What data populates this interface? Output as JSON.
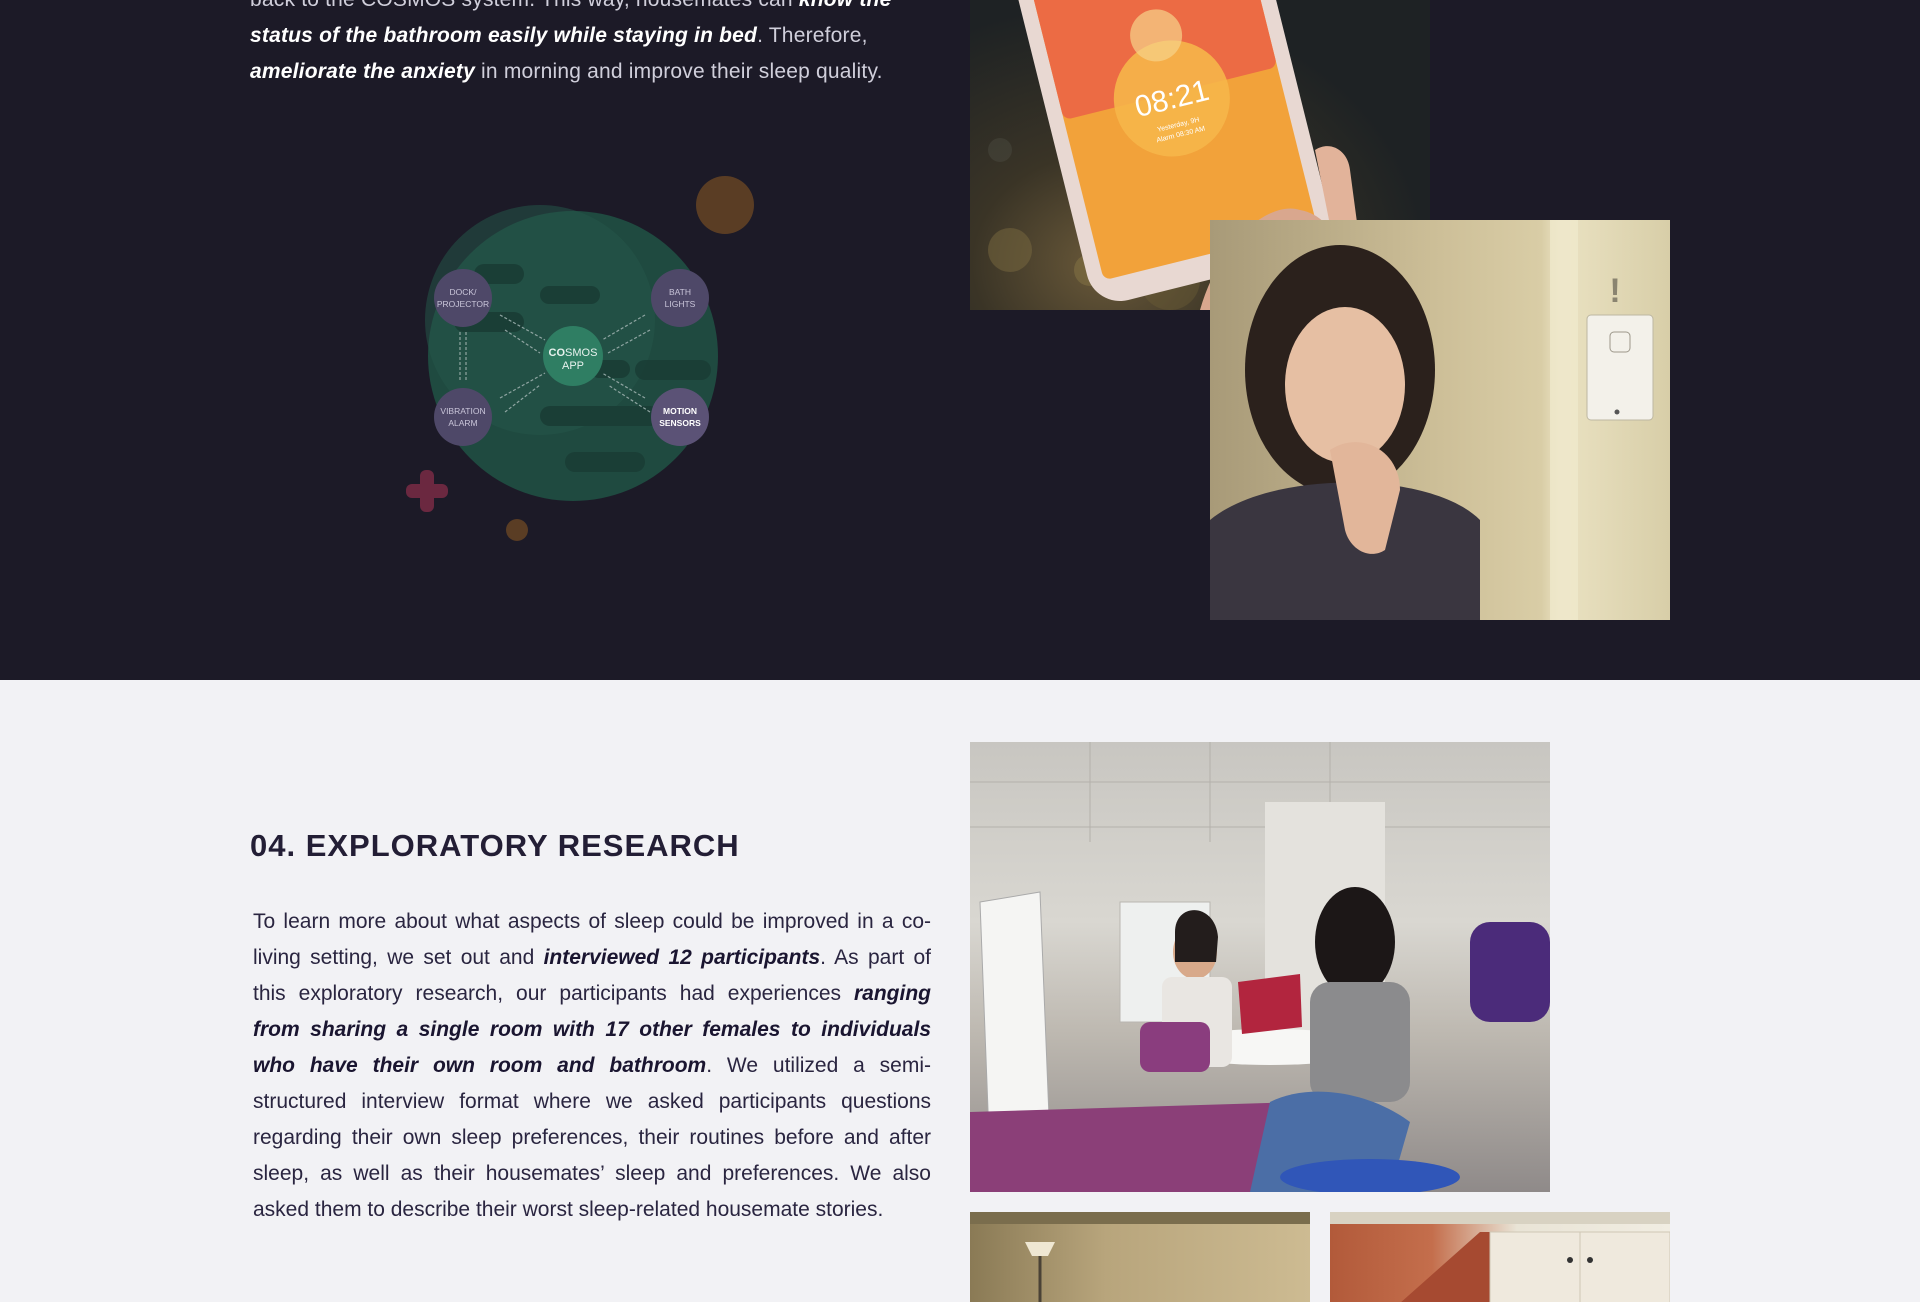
{
  "intro": {
    "line1_a": "back to the COSMOS system. This way, housemates can ",
    "line1_b": "know the status of the bathroom easily while staying in bed",
    "line2_a": ". Therefore, ",
    "line2_b": "ameliorate the anxiety",
    "line2_c": " in morning and improve their sleep quality."
  },
  "diagram": {
    "center_a": "CO",
    "center_b": "SMOS",
    "center_c": "APP",
    "nodes": {
      "dock": [
        "DOCK/",
        "PROJECTOR"
      ],
      "bath": [
        "BATH",
        "LIGHTS"
      ],
      "vibration": [
        "VIBRATION",
        "ALARM"
      ],
      "motion": [
        "MOTION",
        "SENSORS"
      ]
    }
  },
  "phone_screen": {
    "time": "08:21",
    "sub1": "Yesterday, 9H",
    "sub2": "Alarm 08:30 AM"
  },
  "research": {
    "title": "04. EXPLORATORY RESEARCH",
    "p1": "To learn more about what aspects of sleep could be improved in a co-living setting, we set out and ",
    "p1_b": "interviewed 12 participants",
    "p2": ". As part of this exploratory research, our participants had experiences ",
    "p2_b": "ranging from sharing a single room with 17 other females to individuals who have their own room and bathroom",
    "p3": ". We utilized a semi-structured interview format where we asked participants questions regarding their own sleep preferences, their routines before and after sleep, as well as their housemates’ sleep and preferences. We also asked them to describe their worst sleep-related housemate stories."
  },
  "colors": {
    "dark_bg": "#1c1a27",
    "light_bg": "#f2f2f5",
    "title": "#231e35",
    "node_purple": "#5b5276",
    "center_green": "#2f7e63"
  }
}
